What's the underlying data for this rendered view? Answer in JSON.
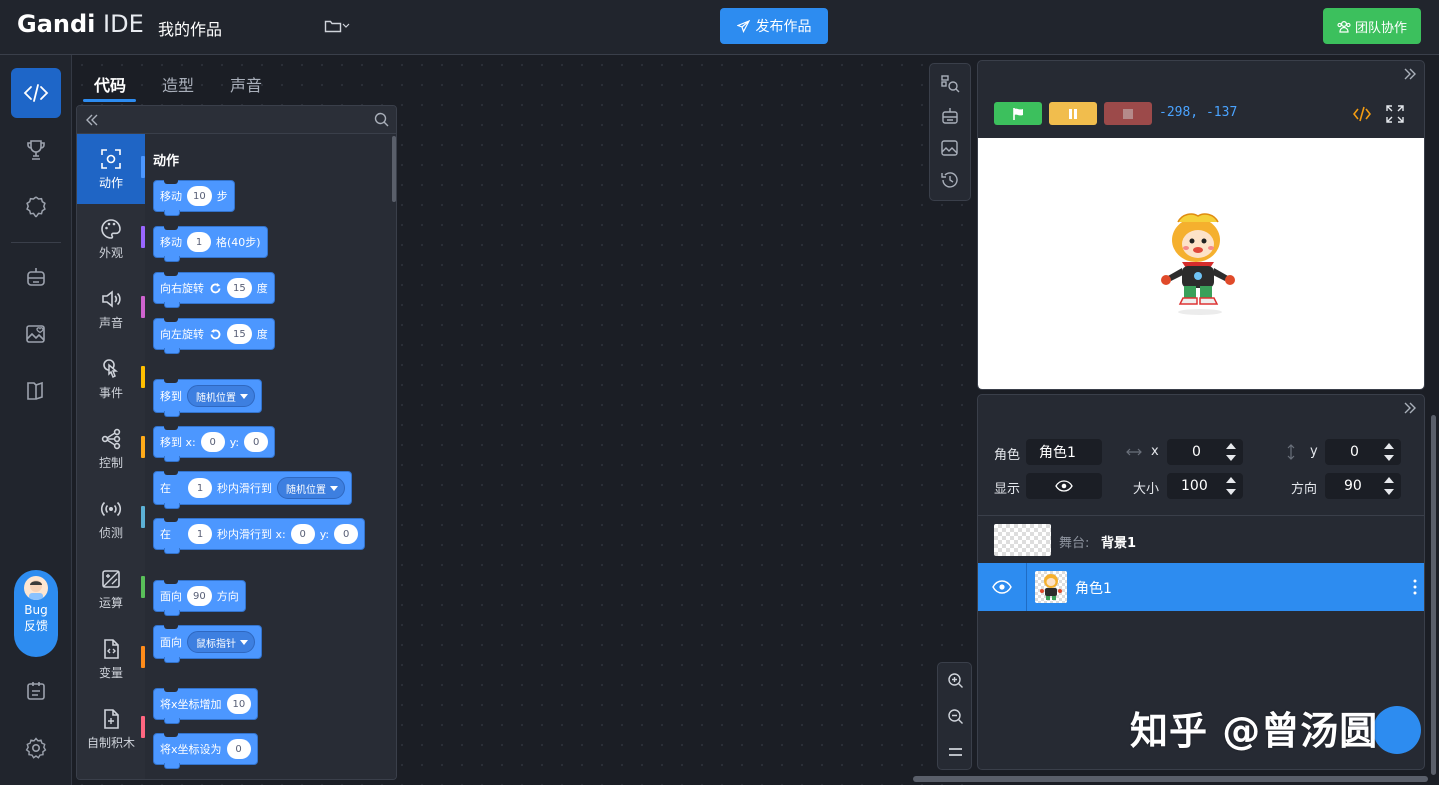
{
  "header": {
    "logo_bold": "Gandi",
    "logo_light": " IDE",
    "project_title": "我的作品",
    "publish_label": "发布作品",
    "team_label": "团队协作"
  },
  "leftnav": {
    "items": [
      "code-icon",
      "trophy-icon",
      "badge-icon",
      "robot-icon",
      "image-heart-icon",
      "book-icon"
    ],
    "bug_label_1": "Bug",
    "bug_label_2": "反馈"
  },
  "tabs": [
    "代码",
    "造型",
    "声音"
  ],
  "palette": {
    "heading": "动作",
    "categories": [
      {
        "label": "动作",
        "color": "#4c97ff"
      },
      {
        "label": "外观",
        "color": "#9966ff"
      },
      {
        "label": "声音",
        "color": "#cf63cf"
      },
      {
        "label": "事件",
        "color": "#ffbf00"
      },
      {
        "label": "控制",
        "color": "#ffab19"
      },
      {
        "label": "侦测",
        "color": "#5cb1d6"
      },
      {
        "label": "运算",
        "color": "#59c059"
      },
      {
        "label": "变量",
        "color": "#ff8c1a"
      },
      {
        "label": "自制积木",
        "color": "#ff6680"
      }
    ],
    "blocks": {
      "move_steps": {
        "a": "移动",
        "v": "10",
        "b": "步"
      },
      "move_grid": {
        "a": "移动",
        "v": "1",
        "b": "格(40步)"
      },
      "turn_right": {
        "a": "向右旋转",
        "v": "15",
        "b": "度"
      },
      "turn_left": {
        "a": "向左旋转",
        "v": "15",
        "b": "度"
      },
      "goto": {
        "a": "移到",
        "d": "随机位置"
      },
      "goto_xy": {
        "a": "移到 x:",
        "x": "0",
        "ylbl": "y:",
        "y": "0"
      },
      "glide": {
        "a": "在",
        "v": "1",
        "b": "秒内滑行到",
        "d": "随机位置"
      },
      "glide_xy": {
        "a": "在",
        "v": "1",
        "b": "秒内滑行到 x:",
        "x": "0",
        "ylbl": "y:",
        "y": "0"
      },
      "point_dir": {
        "a": "面向",
        "v": "90",
        "b": "方向"
      },
      "point_towards": {
        "a": "面向",
        "d": "鼠标指针"
      },
      "change_x": {
        "a": "将x坐标增加",
        "v": "10"
      },
      "set_x": {
        "a": "将x坐标设为",
        "v": "0"
      }
    }
  },
  "stage": {
    "coords": "-298, -137"
  },
  "sprite_panel": {
    "sprite_label": "角色",
    "sprite_name": "角色1",
    "x_label": "x",
    "x_value": "0",
    "y_label": "y",
    "y_value": "0",
    "show_label": "显示",
    "size_label": "大小",
    "size_value": "100",
    "direction_label": "方向",
    "direction_value": "90",
    "stage_prefix": "舞台:",
    "backdrop_name": "背景1",
    "sprite_list_name": "角色1"
  },
  "watermark": "知乎 @曾汤圆",
  "colors": {
    "accent": "#2d8cf0",
    "success": "#3cc05d",
    "motion": "#4c97ff",
    "pause": "#f1bd4d",
    "stop": "#9c4a4a"
  }
}
